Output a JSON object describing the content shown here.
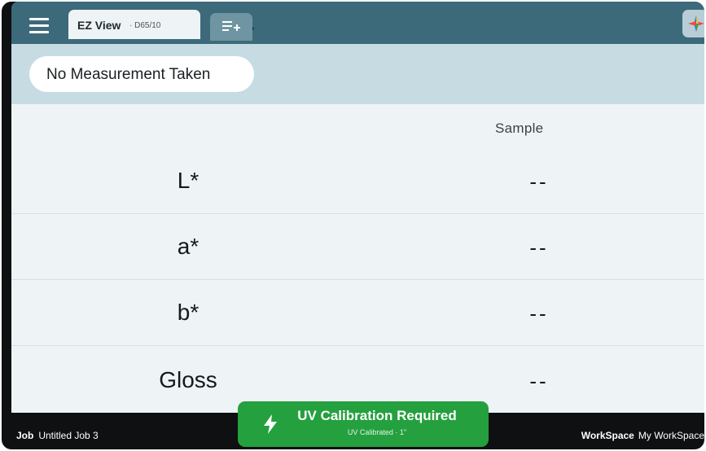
{
  "toolbar": {
    "view_title": "EZ View",
    "view_subtitle": "· D65/10",
    "menu_icon": "hamburger-menu-icon",
    "edit_icon": "pencil-icon",
    "add_icon": "add-list-icon",
    "logo_icon": "app-logo-icon"
  },
  "status": {
    "message": "No Measurement Taken"
  },
  "table": {
    "column_header": "Sample",
    "rows": [
      {
        "label": "L*",
        "value": "--"
      },
      {
        "label": "a*",
        "value": "--"
      },
      {
        "label": "b*",
        "value": "--"
      },
      {
        "label": "Gloss",
        "value": "--"
      }
    ]
  },
  "footer": {
    "job_label": "Job",
    "job_name": "Untitled Job 3",
    "workspace_label": "WorkSpace",
    "workspace_name": "My WorkSpace",
    "uv_title": "UV Calibration Required",
    "uv_subtitle": "UV Calibrated · 1\"",
    "uv_icon": "lightning-bolt-icon"
  },
  "colors": {
    "topbar": "#3c6a7b",
    "status_strip": "#c6dce2",
    "panel": "#eef4f6",
    "uv_button": "#25a03f",
    "bottom_bar": "#0e1012"
  }
}
